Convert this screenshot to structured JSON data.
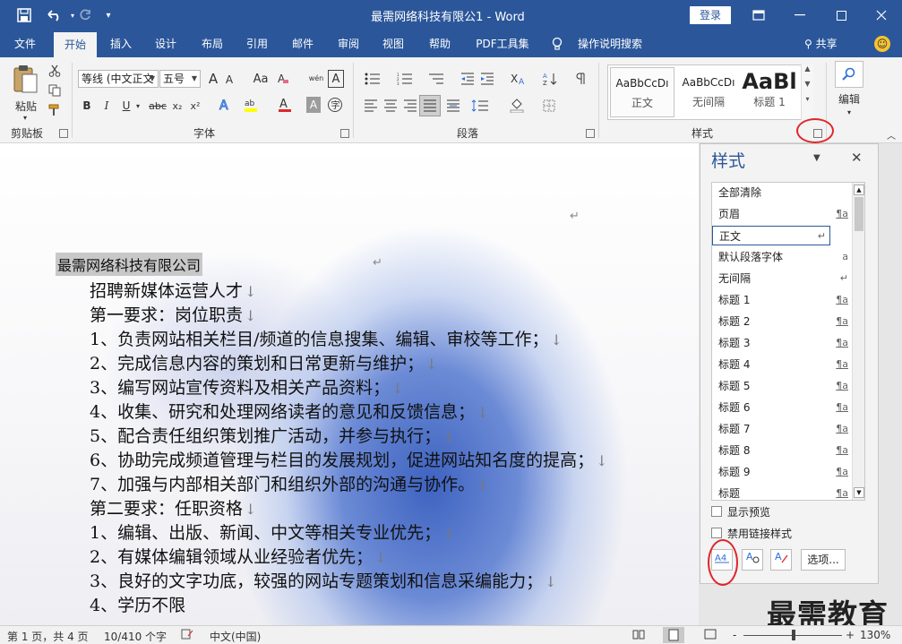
{
  "titlebar": {
    "title": "最需网络科技有限公1 - Word",
    "login_label": "登录",
    "save_icon": "save-icon",
    "undo_icon": "undo-icon",
    "redo_icon": "redo-icon"
  },
  "tabs": [
    {
      "label": "文件"
    },
    {
      "label": "开始"
    },
    {
      "label": "插入"
    },
    {
      "label": "设计"
    },
    {
      "label": "布局"
    },
    {
      "label": "引用"
    },
    {
      "label": "邮件"
    },
    {
      "label": "审阅"
    },
    {
      "label": "视图"
    },
    {
      "label": "帮助"
    },
    {
      "label": "PDF工具集"
    },
    {
      "label": "操作说明搜索"
    }
  ],
  "share_label": "共享",
  "ribbon": {
    "clipboard": {
      "paste_label": "粘贴",
      "group_label": "剪贴板"
    },
    "font": {
      "font_name": "等线 (中文正文",
      "font_size": "五号",
      "group_label": "字体",
      "bold": "B",
      "italic": "I",
      "underline": "U",
      "strike": "abc",
      "sub": "x₂",
      "sup": "x²",
      "grow": "A",
      "shrink": "A",
      "case": "Aa",
      "phonetic": "wén",
      "border_char": "A"
    },
    "paragraph": {
      "group_label": "段落"
    },
    "styles": {
      "group_label": "样式",
      "cards": [
        {
          "preview": "AaBbCcDı",
          "name": "正文"
        },
        {
          "preview": "AaBbCcDı",
          "name": "无间隔"
        },
        {
          "preview": "AaBl",
          "name": "标题 1"
        }
      ]
    },
    "editing": {
      "label": "编辑"
    }
  },
  "document": {
    "title": "最需网络科技有限公司",
    "lines": [
      "招聘新媒体运营人才",
      "第一要求：岗位职责",
      "1、负责网站相关栏目/频道的信息搜集、编辑、审校等工作；",
      "2、完成信息内容的策划和日常更新与维护；",
      "3、编写网站宣传资料及相关产品资料；",
      "4、收集、研究和处理网络读者的意见和反馈信息；",
      "5、配合责任组织策划推广活动，并参与执行；",
      "6、协助完成频道管理与栏目的发展规划，促进网站知名度的提高；",
      "7、加强与内部相关部门和组织外部的沟通与协作。",
      "第二要求：任职资格",
      "1、编辑、出版、新闻、中文等相关专业优先；",
      "2、有媒体编辑领域从业经验者优先；",
      "3、良好的文字功底，较强的网站专题策划和信息采编能力；",
      "4、学历不限"
    ],
    "para_mark": "↓",
    "return_mark": "↵"
  },
  "styles_pane": {
    "title": "样式",
    "items": [
      {
        "name": "全部清除",
        "mark": ""
      },
      {
        "name": "页眉",
        "mark": "¶a"
      },
      {
        "name": "正文",
        "mark": "↵"
      },
      {
        "name": "默认段落字体",
        "mark": "a"
      },
      {
        "name": "无间隔",
        "mark": "↵"
      },
      {
        "name": "标题 1",
        "mark": "¶a"
      },
      {
        "name": "标题 2",
        "mark": "¶a"
      },
      {
        "name": "标题 3",
        "mark": "¶a"
      },
      {
        "name": "标题 4",
        "mark": "¶a"
      },
      {
        "name": "标题 5",
        "mark": "¶a"
      },
      {
        "name": "标题 6",
        "mark": "¶a"
      },
      {
        "name": "标题 7",
        "mark": "¶a"
      },
      {
        "name": "标题 8",
        "mark": "¶a"
      },
      {
        "name": "标题 9",
        "mark": "¶a"
      },
      {
        "name": "标题",
        "mark": "¶a"
      }
    ],
    "selected_index": 2,
    "show_preview": "显示预览",
    "disable_linked": "禁用链接样式",
    "new_style_icon": "A4",
    "inspector_icon": "A",
    "manage_icon": "A",
    "options_label": "选项..."
  },
  "statusbar": {
    "page": "第 1 页，共 4 页",
    "words": "10/410 个字",
    "language": "中文(中国)",
    "zoom": "130%",
    "zoom_minus": "-",
    "zoom_plus": "+"
  },
  "watermark": "最需教育"
}
